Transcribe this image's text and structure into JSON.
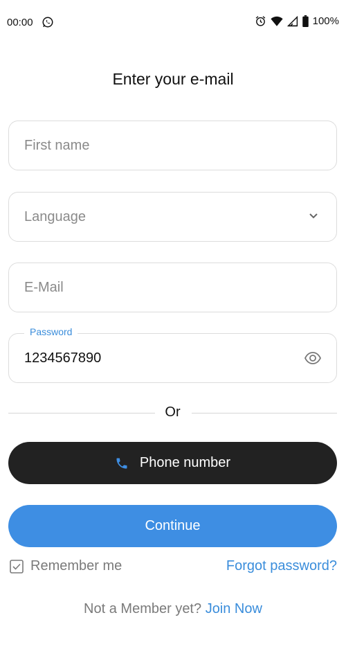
{
  "status_bar": {
    "time": "00:00",
    "battery": "100%",
    "icons": [
      "whatsapp-icon",
      "alarm-icon",
      "wifi-icon",
      "signal-icon",
      "battery-icon"
    ]
  },
  "title": "Enter your e-mail",
  "form": {
    "first_name": {
      "placeholder": "First name",
      "value": ""
    },
    "language": {
      "placeholder": "Language",
      "value": "",
      "icon": "chevron-down-icon"
    },
    "email": {
      "placeholder": "E-Mail",
      "value": ""
    },
    "password": {
      "label": "Password",
      "value": "1234567890",
      "icon": "eye-icon"
    }
  },
  "divider": {
    "text": "Or"
  },
  "buttons": {
    "phone": {
      "label": "Phone number",
      "icon": "phone-icon"
    },
    "continue": {
      "label": "Continue"
    }
  },
  "remember": {
    "label": "Remember me",
    "checked": true
  },
  "forgot": {
    "label": "Forgot password?"
  },
  "signup": {
    "prefix": "Not a Member yet?",
    "link": "Join Now"
  },
  "colors": {
    "accent": "#3e8ee3",
    "link": "#3a8ddb",
    "dark_button": "#222222",
    "border": "#dcdcdc",
    "muted_text": "#7a7a7a"
  }
}
